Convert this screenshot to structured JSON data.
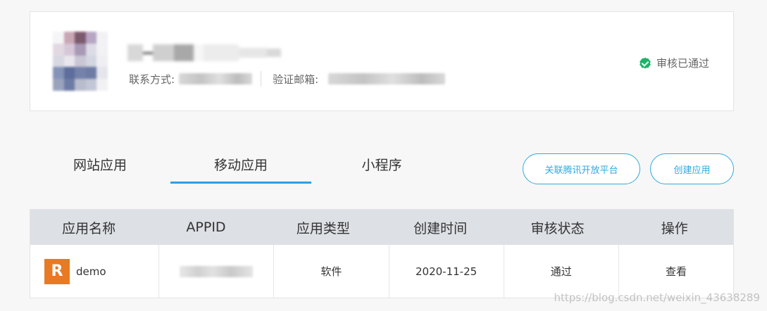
{
  "profile": {
    "contact_label": "联系方式:",
    "email_label": "验证邮箱:",
    "status_text": "审核已通过",
    "status_color": "#1cb36a"
  },
  "tabs": [
    {
      "label": "网站应用",
      "active": false
    },
    {
      "label": "移动应用",
      "active": true
    },
    {
      "label": "小程序",
      "active": false
    }
  ],
  "actions": {
    "link_tencent": "关联腾讯开放平台",
    "create_app": "创建应用"
  },
  "table": {
    "headers": [
      "应用名称",
      "APPID",
      "应用类型",
      "创建时间",
      "审核状态",
      "操作"
    ],
    "rows": [
      {
        "icon_letter": "R",
        "name": "demo",
        "appid": "",
        "type": "软件",
        "created": "2020-11-25",
        "status": "通过",
        "action": "查看"
      }
    ]
  },
  "watermark": "https://blog.csdn.net/weixin_43638289",
  "colors": {
    "accent": "#2eabdf",
    "success": "#1cb36a",
    "tab_underline": "#2d9fe0",
    "header_bg": "#dde0e4",
    "app_icon": "#e87a24"
  }
}
